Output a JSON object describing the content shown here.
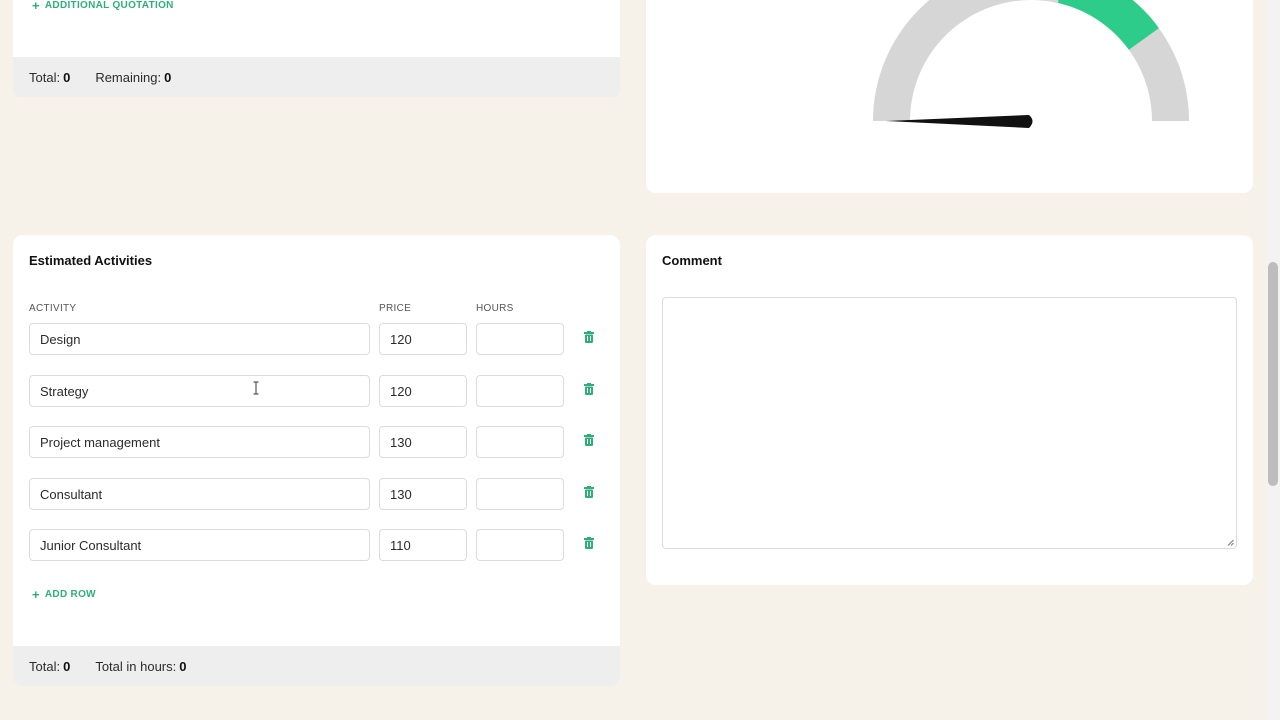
{
  "quotation": {
    "add_label": "ADDITIONAL QUOTATION",
    "total_label": "Total:",
    "total_value": "0",
    "remaining_label": "Remaining:",
    "remaining_value": "0"
  },
  "gauge": {
    "accent_color": "#2ecc8b",
    "track_color": "#d6d6d6",
    "needle_color": "#111111"
  },
  "activities": {
    "title": "Estimated Activities",
    "columns": {
      "activity": "ACTIVITY",
      "price": "PRICE",
      "hours": "HOURS"
    },
    "rows": [
      {
        "activity": "Design",
        "price": "120",
        "hours": ""
      },
      {
        "activity": "Strategy",
        "price": "120",
        "hours": ""
      },
      {
        "activity": "Project management",
        "price": "130",
        "hours": ""
      },
      {
        "activity": "Consultant",
        "price": "130",
        "hours": ""
      },
      {
        "activity": "Junior Consultant",
        "price": "110",
        "hours": ""
      }
    ],
    "add_row_label": "ADD ROW",
    "total_label": "Total:",
    "total_value": "0",
    "total_hours_label": "Total in hours:",
    "total_hours_value": "0",
    "accent_color": "#2fae7a"
  },
  "comment": {
    "title": "Comment",
    "value": ""
  }
}
